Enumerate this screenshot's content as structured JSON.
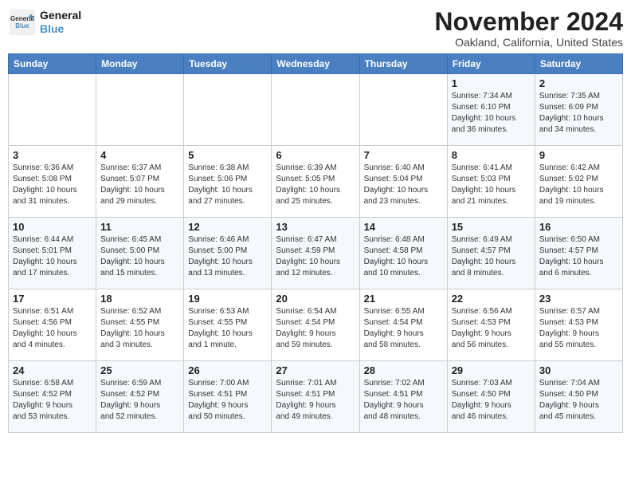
{
  "header": {
    "logo_line1": "General",
    "logo_line2": "Blue",
    "month": "November 2024",
    "location": "Oakland, California, United States"
  },
  "weekdays": [
    "Sunday",
    "Monday",
    "Tuesday",
    "Wednesday",
    "Thursday",
    "Friday",
    "Saturday"
  ],
  "weeks": [
    [
      {
        "day": "",
        "info": ""
      },
      {
        "day": "",
        "info": ""
      },
      {
        "day": "",
        "info": ""
      },
      {
        "day": "",
        "info": ""
      },
      {
        "day": "",
        "info": ""
      },
      {
        "day": "1",
        "info": "Sunrise: 7:34 AM\nSunset: 6:10 PM\nDaylight: 10 hours\nand 36 minutes."
      },
      {
        "day": "2",
        "info": "Sunrise: 7:35 AM\nSunset: 6:09 PM\nDaylight: 10 hours\nand 34 minutes."
      }
    ],
    [
      {
        "day": "3",
        "info": "Sunrise: 6:36 AM\nSunset: 5:08 PM\nDaylight: 10 hours\nand 31 minutes."
      },
      {
        "day": "4",
        "info": "Sunrise: 6:37 AM\nSunset: 5:07 PM\nDaylight: 10 hours\nand 29 minutes."
      },
      {
        "day": "5",
        "info": "Sunrise: 6:38 AM\nSunset: 5:06 PM\nDaylight: 10 hours\nand 27 minutes."
      },
      {
        "day": "6",
        "info": "Sunrise: 6:39 AM\nSunset: 5:05 PM\nDaylight: 10 hours\nand 25 minutes."
      },
      {
        "day": "7",
        "info": "Sunrise: 6:40 AM\nSunset: 5:04 PM\nDaylight: 10 hours\nand 23 minutes."
      },
      {
        "day": "8",
        "info": "Sunrise: 6:41 AM\nSunset: 5:03 PM\nDaylight: 10 hours\nand 21 minutes."
      },
      {
        "day": "9",
        "info": "Sunrise: 6:42 AM\nSunset: 5:02 PM\nDaylight: 10 hours\nand 19 minutes."
      }
    ],
    [
      {
        "day": "10",
        "info": "Sunrise: 6:44 AM\nSunset: 5:01 PM\nDaylight: 10 hours\nand 17 minutes."
      },
      {
        "day": "11",
        "info": "Sunrise: 6:45 AM\nSunset: 5:00 PM\nDaylight: 10 hours\nand 15 minutes."
      },
      {
        "day": "12",
        "info": "Sunrise: 6:46 AM\nSunset: 5:00 PM\nDaylight: 10 hours\nand 13 minutes."
      },
      {
        "day": "13",
        "info": "Sunrise: 6:47 AM\nSunset: 4:59 PM\nDaylight: 10 hours\nand 12 minutes."
      },
      {
        "day": "14",
        "info": "Sunrise: 6:48 AM\nSunset: 4:58 PM\nDaylight: 10 hours\nand 10 minutes."
      },
      {
        "day": "15",
        "info": "Sunrise: 6:49 AM\nSunset: 4:57 PM\nDaylight: 10 hours\nand 8 minutes."
      },
      {
        "day": "16",
        "info": "Sunrise: 6:50 AM\nSunset: 4:57 PM\nDaylight: 10 hours\nand 6 minutes."
      }
    ],
    [
      {
        "day": "17",
        "info": "Sunrise: 6:51 AM\nSunset: 4:56 PM\nDaylight: 10 hours\nand 4 minutes."
      },
      {
        "day": "18",
        "info": "Sunrise: 6:52 AM\nSunset: 4:55 PM\nDaylight: 10 hours\nand 3 minutes."
      },
      {
        "day": "19",
        "info": "Sunrise: 6:53 AM\nSunset: 4:55 PM\nDaylight: 10 hours\nand 1 minute."
      },
      {
        "day": "20",
        "info": "Sunrise: 6:54 AM\nSunset: 4:54 PM\nDaylight: 9 hours\nand 59 minutes."
      },
      {
        "day": "21",
        "info": "Sunrise: 6:55 AM\nSunset: 4:54 PM\nDaylight: 9 hours\nand 58 minutes."
      },
      {
        "day": "22",
        "info": "Sunrise: 6:56 AM\nSunset: 4:53 PM\nDaylight: 9 hours\nand 56 minutes."
      },
      {
        "day": "23",
        "info": "Sunrise: 6:57 AM\nSunset: 4:53 PM\nDaylight: 9 hours\nand 55 minutes."
      }
    ],
    [
      {
        "day": "24",
        "info": "Sunrise: 6:58 AM\nSunset: 4:52 PM\nDaylight: 9 hours\nand 53 minutes."
      },
      {
        "day": "25",
        "info": "Sunrise: 6:59 AM\nSunset: 4:52 PM\nDaylight: 9 hours\nand 52 minutes."
      },
      {
        "day": "26",
        "info": "Sunrise: 7:00 AM\nSunset: 4:51 PM\nDaylight: 9 hours\nand 50 minutes."
      },
      {
        "day": "27",
        "info": "Sunrise: 7:01 AM\nSunset: 4:51 PM\nDaylight: 9 hours\nand 49 minutes."
      },
      {
        "day": "28",
        "info": "Sunrise: 7:02 AM\nSunset: 4:51 PM\nDaylight: 9 hours\nand 48 minutes."
      },
      {
        "day": "29",
        "info": "Sunrise: 7:03 AM\nSunset: 4:50 PM\nDaylight: 9 hours\nand 46 minutes."
      },
      {
        "day": "30",
        "info": "Sunrise: 7:04 AM\nSunset: 4:50 PM\nDaylight: 9 hours\nand 45 minutes."
      }
    ]
  ]
}
